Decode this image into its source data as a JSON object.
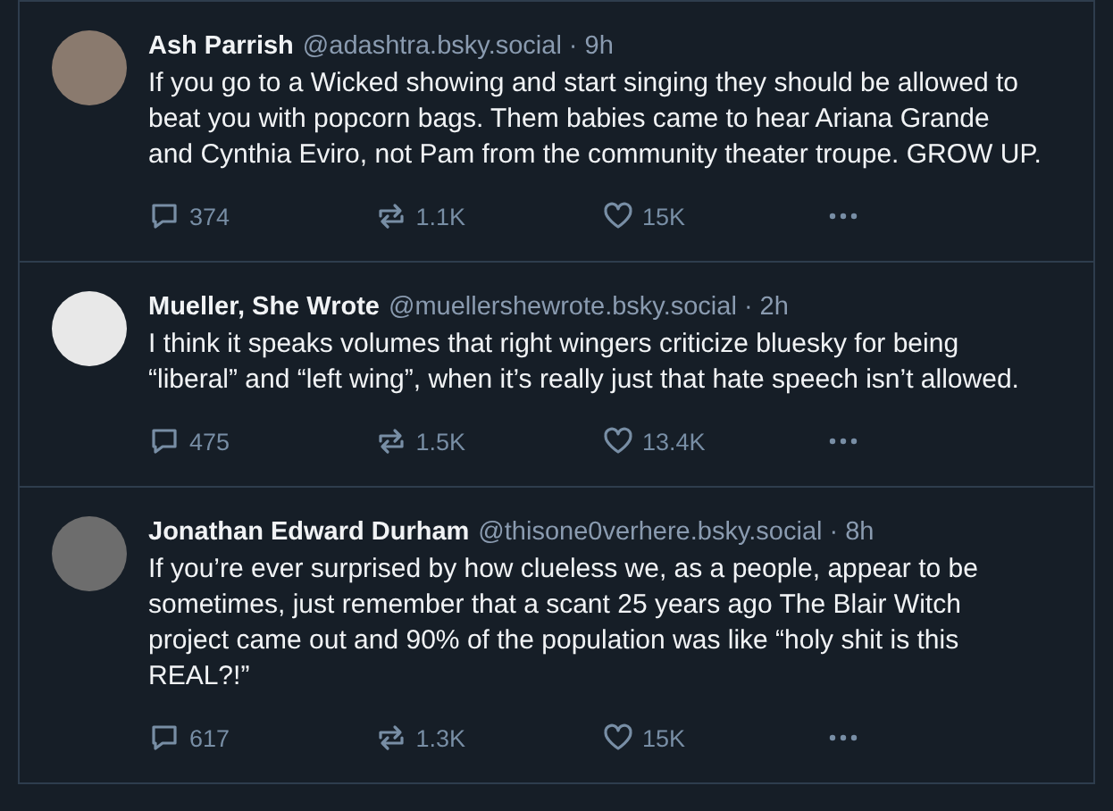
{
  "posts": [
    {
      "name": "Ash Parrish",
      "handle": "@adashtra.bsky.social",
      "time": "· 9h",
      "text": "If you go to a Wicked showing and start singing they should be allowed to beat you with popcorn bags. Them babies came to hear Ariana Grande and Cynthia Eviro, not Pam from the community theater troupe. GROW UP.",
      "replies": "374",
      "reposts": "1.1K",
      "likes": "15K"
    },
    {
      "name": "Mueller, She Wrote",
      "handle": "@muellershewrote.bsky.social",
      "time": "· 2h",
      "text": "I think it speaks volumes that right wingers criticize bluesky for being “liberal” and “left wing”, when it’s really just that hate speech isn’t allowed.",
      "replies": "475",
      "reposts": "1.5K",
      "likes": "13.4K"
    },
    {
      "name": "Jonathan Edward Durham",
      "handle": "@thisone0verhere.bsky.social",
      "time": "· 8h",
      "text": "If you’re ever surprised by how clueless we, as a people, appear to be sometimes, just remember that a scant 25 years ago The Blair Witch project came out and 90% of the population was like “holy shit is this REAL?!”",
      "replies": "617",
      "reposts": "1.3K",
      "likes": "15K"
    }
  ]
}
